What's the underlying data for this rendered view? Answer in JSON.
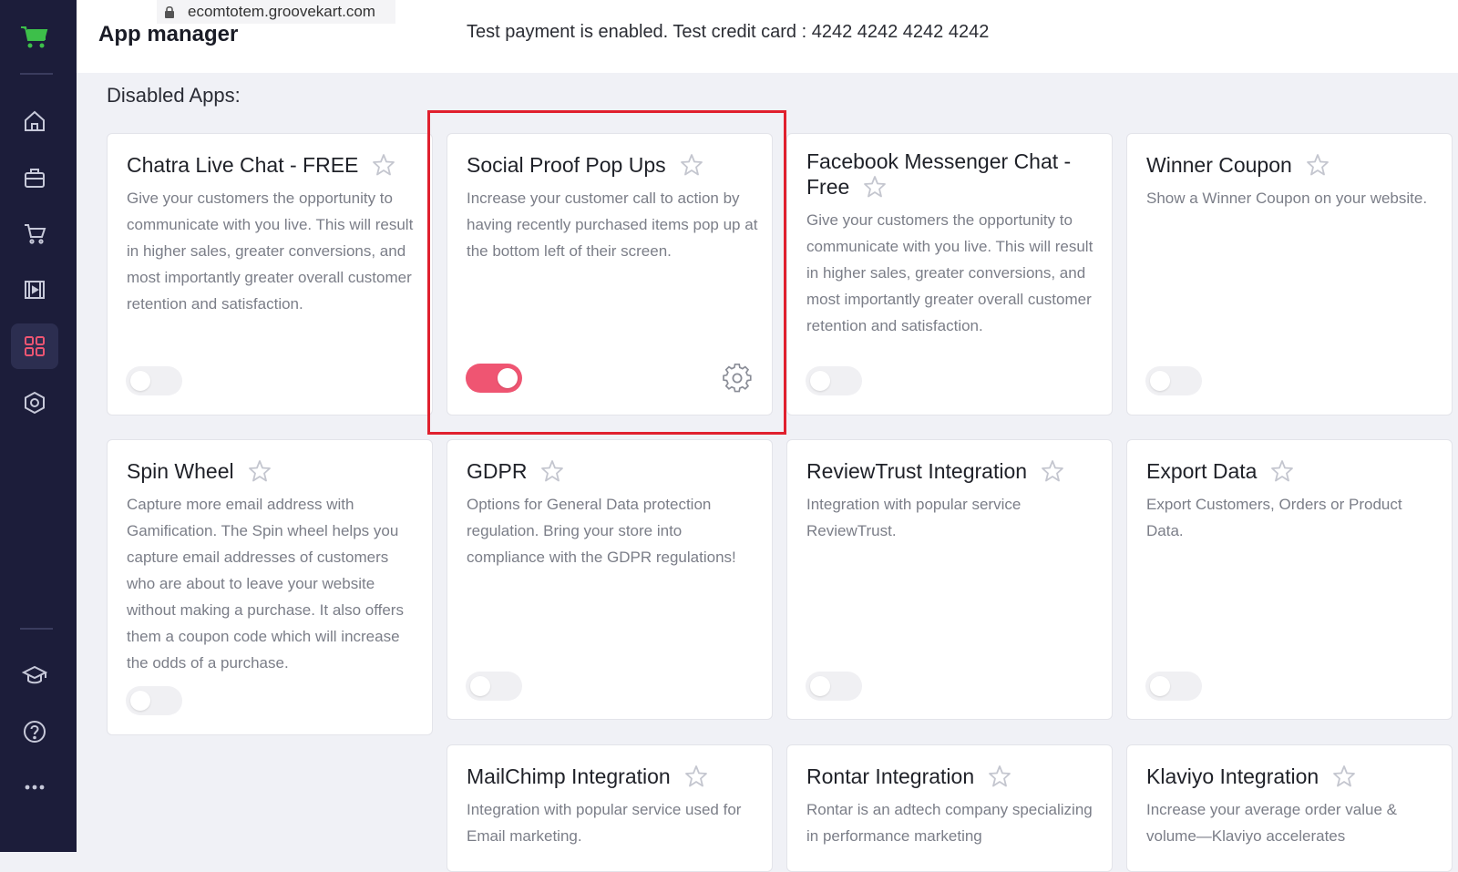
{
  "browser": {
    "url": "ecomtotem.groovekart.com"
  },
  "header": {
    "title": "App manager",
    "notice": "Test payment is enabled. Test credit card : 4242 4242 4242 4242"
  },
  "sidebar": {
    "icons": [
      "cart-logo-icon",
      "home-icon",
      "products-icon",
      "cart-icon",
      "media-icon",
      "apps-grid-icon",
      "settings-hex-icon",
      "academy-cap-icon",
      "help-icon",
      "more-dots-icon"
    ],
    "active": "apps-grid-icon"
  },
  "section": {
    "title": "Disabled Apps:"
  },
  "colors": {
    "accent": "#ef5572",
    "sidebar": "#1c1d3a",
    "highlight": "#e0202e"
  },
  "apps": [
    {
      "title": "Chatra Live Chat - FREE",
      "description": "Give your customers the opportunity to communicate with you live. This will result in higher sales, greater conversions, and most importantly greater overall customer retention and satisfaction.",
      "enabled": false
    },
    {
      "title": "Social Proof Pop Ups",
      "description": "Increase your customer call to action by having recently purchased items pop up at the bottom left of their screen.",
      "enabled": true
    },
    {
      "title": "Facebook Messenger Chat - Free",
      "description": "Give your customers the opportunity to communicate with you live. This will result in higher sales, greater conversions, and most importantly greater overall customer retention and satisfaction.",
      "enabled": false
    },
    {
      "title": "Winner Coupon",
      "description": "Show a Winner Coupon on your website.",
      "enabled": false
    },
    {
      "title": "Spin Wheel",
      "description": "Capture more email address with Gamification. The Spin wheel helps you capture email addresses of customers who are about to leave your website without making a purchase. It also offers them a coupon code which will increase the odds of a purchase.",
      "enabled": false
    },
    {
      "title": "GDPR",
      "description": "Options for General Data protection regulation. Bring your store into compliance with the GDPR regulations!",
      "enabled": false
    },
    {
      "title": "ReviewTrust Integration",
      "description": "Integration with popular service ReviewTrust.",
      "enabled": false
    },
    {
      "title": "Export Data",
      "description": "Export Customers, Orders or Product Data.",
      "enabled": false
    },
    {
      "title": "MailChimp Integration",
      "description": "Integration with popular service used for Email marketing."
    },
    {
      "title": "Rontar Integration",
      "description": "Rontar is an adtech company specializing in performance marketing"
    },
    {
      "title": "Klaviyo Integration",
      "description": "Increase your average order value & volume—Klaviyo accelerates"
    }
  ]
}
